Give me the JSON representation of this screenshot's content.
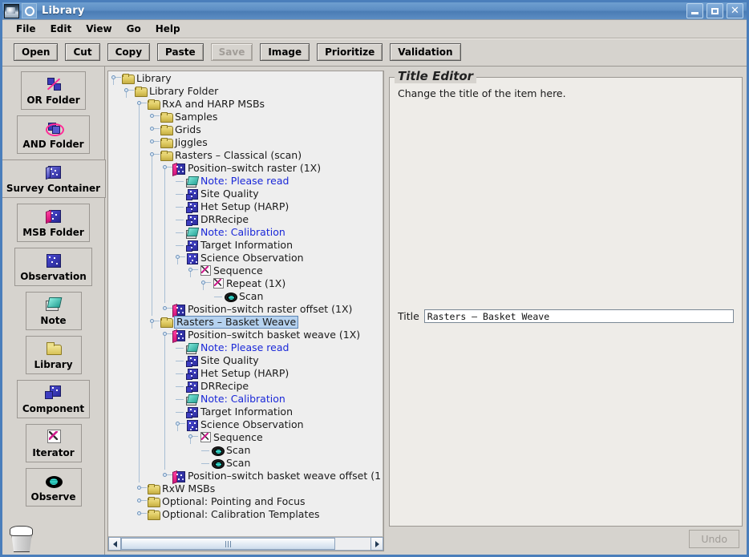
{
  "window": {
    "title": "Library",
    "app_icon": "ship-icon",
    "doc_icon": "document-ring-icon",
    "minimize": "_",
    "maximize": "□",
    "close": "✕"
  },
  "menubar": {
    "items": [
      {
        "label": "File"
      },
      {
        "label": "Edit"
      },
      {
        "label": "View"
      },
      {
        "label": "Go"
      },
      {
        "label": "Help"
      }
    ]
  },
  "toolbar": {
    "buttons": [
      {
        "label": "Open",
        "disabled": false
      },
      {
        "label": "Cut",
        "disabled": false
      },
      {
        "label": "Copy",
        "disabled": false
      },
      {
        "label": "Paste",
        "disabled": false
      },
      {
        "label": "Save",
        "disabled": true
      },
      {
        "label": "Image",
        "disabled": false
      },
      {
        "label": "Prioritize",
        "disabled": false
      },
      {
        "label": "Validation",
        "disabled": false
      }
    ]
  },
  "palette": {
    "items": [
      {
        "label": "OR Folder",
        "icon": "or-folder-icon"
      },
      {
        "label": "AND Folder",
        "icon": "and-folder-icon"
      },
      {
        "label": "Survey Container",
        "icon": "survey-container-icon"
      },
      {
        "label": "MSB Folder",
        "icon": "msb-folder-icon"
      },
      {
        "label": "Observation",
        "icon": "observation-icon"
      },
      {
        "label": "Note",
        "icon": "note-icon"
      },
      {
        "label": "Library",
        "icon": "library-folder-icon"
      },
      {
        "label": "Component",
        "icon": "component-icon"
      },
      {
        "label": "Iterator",
        "icon": "iterator-icon"
      },
      {
        "label": "Observe",
        "icon": "observe-eye-icon"
      }
    ],
    "trash": "trash-icon"
  },
  "tree": {
    "nodes": [
      {
        "depth": 0,
        "handle": "expanded",
        "icon": "folder",
        "label": "Library",
        "style": "normal"
      },
      {
        "depth": 1,
        "handle": "expanded",
        "icon": "folder",
        "label": "Library Folder",
        "style": "normal"
      },
      {
        "depth": 2,
        "handle": "expanded",
        "icon": "folder",
        "label": "RxA and HARP MSBs",
        "style": "normal"
      },
      {
        "depth": 3,
        "handle": "collapsed",
        "icon": "folder",
        "label": "Samples",
        "style": "normal"
      },
      {
        "depth": 3,
        "handle": "collapsed",
        "icon": "folder",
        "label": "Grids",
        "style": "normal"
      },
      {
        "depth": 3,
        "handle": "collapsed",
        "icon": "folder",
        "label": "Jiggles",
        "style": "normal"
      },
      {
        "depth": 3,
        "handle": "expanded",
        "icon": "folder",
        "label": "Rasters – Classical (scan)",
        "style": "normal"
      },
      {
        "depth": 4,
        "handle": "expanded",
        "icon": "msb",
        "label": "Position–switch raster (1X)",
        "style": "normal"
      },
      {
        "depth": 5,
        "handle": "leaf",
        "icon": "note",
        "label": "Note: Please read",
        "style": "note"
      },
      {
        "depth": 5,
        "handle": "leaf",
        "icon": "component",
        "label": "Site Quality",
        "style": "normal"
      },
      {
        "depth": 5,
        "handle": "leaf",
        "icon": "component",
        "label": "Het Setup (HARP)",
        "style": "normal"
      },
      {
        "depth": 5,
        "handle": "leaf",
        "icon": "component",
        "label": "DRRecipe",
        "style": "normal"
      },
      {
        "depth": 5,
        "handle": "leaf",
        "icon": "note",
        "label": "Note: Calibration",
        "style": "note"
      },
      {
        "depth": 5,
        "handle": "leaf",
        "icon": "component",
        "label": "Target Information",
        "style": "normal"
      },
      {
        "depth": 5,
        "handle": "expanded",
        "icon": "observation",
        "label": "Science Observation",
        "style": "normal"
      },
      {
        "depth": 6,
        "handle": "expanded",
        "icon": "iterator",
        "label": "Sequence",
        "style": "normal"
      },
      {
        "depth": 7,
        "handle": "expanded",
        "icon": "iterator",
        "label": "Repeat (1X)",
        "style": "normal"
      },
      {
        "depth": 8,
        "handle": "leaf",
        "icon": "scan",
        "label": "Scan",
        "style": "normal"
      },
      {
        "depth": 4,
        "handle": "collapsed",
        "icon": "msb",
        "label": "Position–switch raster offset (1X)",
        "style": "normal"
      },
      {
        "depth": 3,
        "handle": "expanded",
        "icon": "folder",
        "label": "Rasters – Basket Weave",
        "style": "selected"
      },
      {
        "depth": 4,
        "handle": "expanded",
        "icon": "msb",
        "label": "Position–switch basket weave (1X)",
        "style": "normal"
      },
      {
        "depth": 5,
        "handle": "leaf",
        "icon": "note",
        "label": "Note: Please read",
        "style": "note"
      },
      {
        "depth": 5,
        "handle": "leaf",
        "icon": "component",
        "label": "Site Quality",
        "style": "normal"
      },
      {
        "depth": 5,
        "handle": "leaf",
        "icon": "component",
        "label": "Het Setup (HARP)",
        "style": "normal"
      },
      {
        "depth": 5,
        "handle": "leaf",
        "icon": "component",
        "label": "DRRecipe",
        "style": "normal"
      },
      {
        "depth": 5,
        "handle": "leaf",
        "icon": "note",
        "label": "Note: Calibration",
        "style": "note"
      },
      {
        "depth": 5,
        "handle": "leaf",
        "icon": "component",
        "label": "Target Information",
        "style": "normal"
      },
      {
        "depth": 5,
        "handle": "expanded",
        "icon": "observation",
        "label": "Science Observation",
        "style": "normal"
      },
      {
        "depth": 6,
        "handle": "expanded",
        "icon": "iterator",
        "label": "Sequence",
        "style": "normal"
      },
      {
        "depth": 7,
        "handle": "leaf",
        "icon": "scan",
        "label": "Scan",
        "style": "normal"
      },
      {
        "depth": 7,
        "handle": "leaf",
        "icon": "scan",
        "label": "Scan",
        "style": "normal"
      },
      {
        "depth": 4,
        "handle": "collapsed",
        "icon": "msb",
        "label": "Position–switch basket weave offset (1",
        "style": "normal"
      },
      {
        "depth": 2,
        "handle": "collapsed",
        "icon": "folder",
        "label": "RxW MSBs",
        "style": "normal"
      },
      {
        "depth": 2,
        "handle": "collapsed",
        "icon": "folder",
        "label": "Optional: Pointing and Focus",
        "style": "normal"
      },
      {
        "depth": 2,
        "handle": "collapsed",
        "icon": "folder",
        "label": "Optional: Calibration Templates",
        "style": "normal"
      }
    ],
    "scrollbar": {
      "left_arrow": "◀",
      "right_arrow": "▶",
      "thumb_grip": "grip"
    }
  },
  "editor": {
    "group_title": "Title Editor",
    "description": "Change the title of the item here.",
    "title_label": "Title",
    "title_value": "Rasters – Basket Weave",
    "title_placeholder": "",
    "undo_label": "Undo",
    "undo_disabled": true
  }
}
